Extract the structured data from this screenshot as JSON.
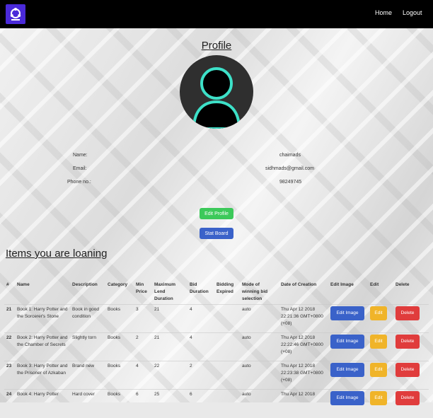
{
  "navbar": {
    "home_label": "Home",
    "logout_label": "Logout"
  },
  "profile": {
    "title": "Profile",
    "fields": [
      {
        "label": "Name:",
        "value": "chaimads"
      },
      {
        "label": "Email:",
        "value": "sidhmads@gmail.com"
      },
      {
        "label": "Phone no.:",
        "value": "98249745"
      }
    ],
    "edit_profile_label": "Edit Profile",
    "stat_board_label": "Stat Board"
  },
  "items_section": {
    "title": "Items you are loaning",
    "headers": [
      "#",
      "Name",
      "Description",
      "Category",
      "Min Price",
      "Maximum Lend Duration",
      "Bid Duration",
      "Bidding Expired",
      "Mode of winning bid selection",
      "Date of Creation",
      "Edit Image",
      "Edit",
      "Delete"
    ],
    "rows": [
      {
        "id": "21",
        "name": "Book 1: Harry Potter and the Sorcerer's Stone",
        "description": "Book in good condition",
        "category": "Books",
        "min_price": "3",
        "max_lend": "21",
        "bid_duration": "4",
        "expired": "",
        "mode": "auto",
        "date": "Thu Apr 12 2018 22:21:36 GMT+0800 (+08)"
      },
      {
        "id": "22",
        "name": "Book 2: Harry Potter and the Chamber of Secrets",
        "description": "Slightly torn",
        "category": "Books",
        "min_price": "2",
        "max_lend": "21",
        "bid_duration": "4",
        "expired": "",
        "mode": "auto",
        "date": "Thu Apr 12 2018 22:22:46 GMT+0800 (+08)"
      },
      {
        "id": "23",
        "name": "Book 3: Harry Potter and the Prisoner of Azkaban",
        "description": "Brand new",
        "category": "Books",
        "min_price": "4",
        "max_lend": "22",
        "bid_duration": "2",
        "expired": "",
        "mode": "auto",
        "date": "Thu Apr 12 2018 22:23:38 GMT+0800 (+08)"
      },
      {
        "id": "24",
        "name": "Book 4: Harry Potter",
        "description": "Hard cover",
        "category": "Books",
        "min_price": "6",
        "max_lend": "25",
        "bid_duration": "6",
        "expired": "",
        "mode": "auto",
        "date": "Thu Apr 12 2018"
      }
    ],
    "edit_image_label": "Edit Image",
    "edit_label": "Edit",
    "delete_label": "Delete"
  },
  "colors": {
    "navbar": "#000000",
    "avatar_ring": "#3de0c8",
    "logo": "#4a2ad9"
  }
}
